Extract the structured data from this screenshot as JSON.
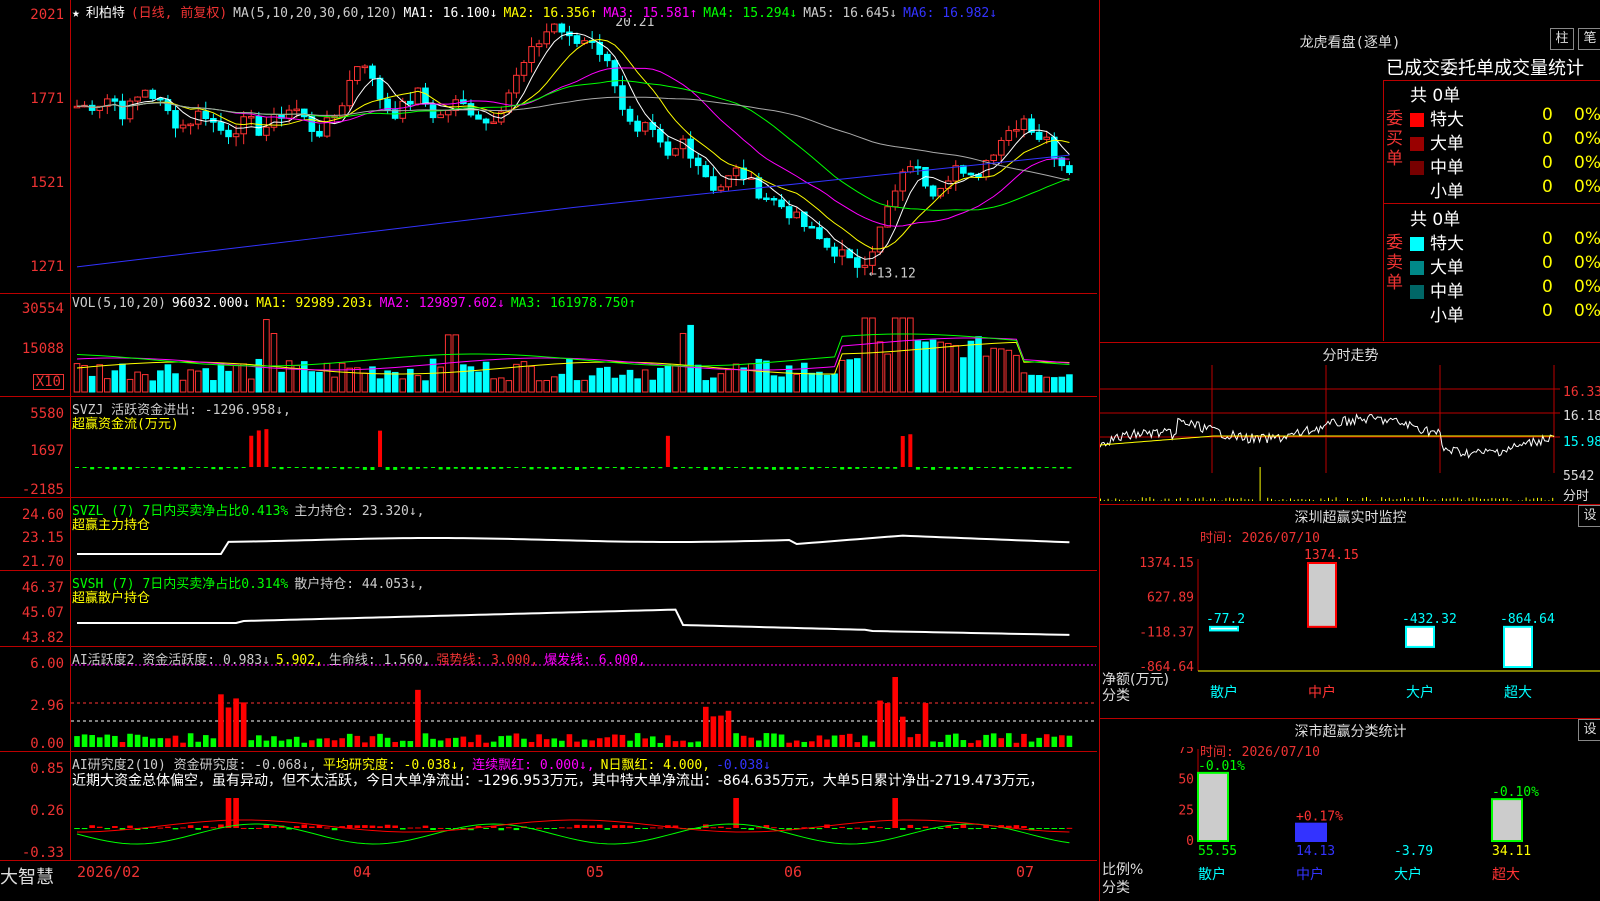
{
  "stock": {
    "star": "★",
    "name": "利柏特",
    "mode": "(日线, 前复权)"
  },
  "main_hdr": [
    {
      "t": "MA(5,10,20,30,60,120)",
      "c": "#ccc"
    },
    {
      "t": "MA1: 16.100↓",
      "c": "#fff"
    },
    {
      "t": "MA2: 16.356↑",
      "c": "#ff0"
    },
    {
      "t": "MA3: 15.581↑",
      "c": "#f0f"
    },
    {
      "t": "MA4: 15.294↓",
      "c": "#0f0"
    },
    {
      "t": "MA5: 16.645↓",
      "c": "#ccc"
    },
    {
      "t": "MA6: 16.982↓",
      "c": "#33f"
    }
  ],
  "main_axis": [
    "2021",
    "1771",
    "1521",
    "1271"
  ],
  "annot": {
    "high": "20.21",
    "low": "←13.12"
  },
  "vol_hdr": [
    {
      "t": "VOL(5,10,20)",
      "c": "#ccc"
    },
    {
      "t": "96032.000↓",
      "c": "#fff"
    },
    {
      "t": "MA1: 92989.203↓",
      "c": "#ff0"
    },
    {
      "t": "MA2: 129897.602↓",
      "c": "#f0f"
    },
    {
      "t": "MA3: 161978.750↑",
      "c": "#0f0"
    }
  ],
  "vol_axis": [
    "30554",
    "15088"
  ],
  "vol_unit": "X10",
  "svzj_hdr": [
    {
      "t": "SVZJ  活跃资金进出: -1296.958↓,",
      "c": "#ccc"
    }
  ],
  "svzj_sub": "超赢资金流(万元)",
  "svzj_axis": [
    "5580",
    "1697",
    "-2185"
  ],
  "svzl_hdr": [
    {
      "t": "SVZL (7) 7日内买卖净占比0.413%",
      "c": "#0f0"
    },
    {
      "t": "主力持仓: 23.320↓,",
      "c": "#ccc"
    }
  ],
  "svzl_sub": "超赢主力持仓",
  "svzl_axis": [
    "24.60",
    "23.15",
    "21.70"
  ],
  "svsh_hdr": [
    {
      "t": "SVSH (7) 7日内买卖净占比0.314%",
      "c": "#0f0"
    },
    {
      "t": "散户持仓: 44.053↓,",
      "c": "#ccc"
    }
  ],
  "svsh_sub": "超赢散户持仓",
  "svsh_axis": [
    "46.37",
    "45.07",
    "43.82"
  ],
  "ai1_hdr": [
    {
      "t": "AI活跃度2 资金活跃度: 0.983↓",
      "c": "#ccc"
    },
    {
      "t": "5.902,",
      "c": "#ff0"
    },
    {
      "t": "生命线: 1.560,",
      "c": "#ccc"
    },
    {
      "t": "强势线: 3.000,",
      "c": "#e33"
    },
    {
      "t": "爆发线: 6.000,",
      "c": "#f0f"
    }
  ],
  "ai1_axis": [
    "6.00",
    "2.96",
    "0.00"
  ],
  "ai2_hdr": [
    {
      "t": "AI研究度2(10) 资金研究度: -0.068↓,",
      "c": "#ccc"
    },
    {
      "t": "平均研究度: -0.038↓,",
      "c": "#ff0"
    },
    {
      "t": "连续飘红: 0.000↓,",
      "c": "#f0f"
    },
    {
      "t": "N日飘红: 4.000,",
      "c": "#ff0"
    },
    {
      "t": "-0.038↓",
      "c": "#33f"
    }
  ],
  "ai2_text": "近期大资金总体偏空，虽有异动，但不太活跃，今日大单净流出：-1296.953万元，其中特大单净流出：-864.635万元，大单5日累计净出-2719.473万元，",
  "ai2_axis": [
    "0.85",
    "0.26",
    "-0.33"
  ],
  "xaxis": {
    "brand": "大智慧",
    "labels": [
      "2026/02",
      "04",
      "05",
      "06",
      "07"
    ]
  },
  "lhb": {
    "title": "龙虎看盘(逐单)",
    "btn1": "柱",
    "btn2": "笔",
    "subtitle": "已成交委托单成交量统计",
    "buy": {
      "label": "委买单",
      "count": "共 0单",
      "rows": [
        {
          "name": "特大",
          "v": "0",
          "p": "0%",
          "c": "#f00"
        },
        {
          "name": "大单",
          "v": "0",
          "p": "0%",
          "c": "#900"
        },
        {
          "name": "中单",
          "v": "0",
          "p": "0%",
          "c": "#700"
        },
        {
          "name": "小单",
          "v": "0",
          "p": "0%",
          "c": "#000"
        }
      ]
    },
    "sell": {
      "label": "委卖单",
      "count": "共 0单",
      "rows": [
        {
          "name": "特大",
          "v": "0",
          "p": "0%",
          "c": "#0ff"
        },
        {
          "name": "大单",
          "v": "0",
          "p": "0%",
          "c": "#088"
        },
        {
          "name": "中单",
          "v": "0",
          "p": "0%",
          "c": "#066"
        },
        {
          "name": "小单",
          "v": "0",
          "p": "0%",
          "c": "#000"
        }
      ]
    }
  },
  "intraday": {
    "title": "分时走势",
    "axis": [
      "16.33",
      "16.18",
      "15.98"
    ],
    "vol": "5542",
    "vlabel": "分时"
  },
  "realtime": {
    "title": "深圳超赢实时监控",
    "btn": "设",
    "time": "时间: 2026/07/10",
    "axis": [
      "1374.15",
      "627.89",
      "-118.37",
      "-864.64"
    ],
    "ylabel": "净额(万元)",
    "xlabel": "分类",
    "bars": [
      {
        "cat": "散户",
        "v": -77.2,
        "label": "-77.2"
      },
      {
        "cat": "中户",
        "v": 1374.15,
        "label": "1374.15"
      },
      {
        "cat": "大户",
        "v": -432.32,
        "label": "-432.32"
      },
      {
        "cat": "超大",
        "v": -864.64,
        "label": "-864.64"
      }
    ]
  },
  "classify": {
    "title": "深市超赢分类统计",
    "btn": "设",
    "time": "时间: 2026/07/10",
    "axis": [
      "75",
      "50",
      "25",
      "0"
    ],
    "ylabel": "比例%",
    "xlabel": "分类",
    "bars": [
      {
        "cat": "散户",
        "v": 55.55,
        "label": "55.55",
        "chg": "-0.01%"
      },
      {
        "cat": "中户",
        "v": 14.13,
        "label": "14.13",
        "chg": "+0.17%"
      },
      {
        "cat": "大户",
        "v": -3.79,
        "label": "-3.79",
        "chg": ""
      },
      {
        "cat": "超大",
        "v": 34.11,
        "label": "34.11",
        "chg": "-0.10%"
      }
    ]
  },
  "chart_data": {
    "type": "line",
    "title": "利柏特 (日线, 前复权)",
    "x": [
      "2026/02",
      "04",
      "05",
      "06",
      "07"
    ],
    "ylim": [
      12.71,
      20.21
    ],
    "annotations": {
      "high": 20.21,
      "low": 13.12
    },
    "series": [
      {
        "name": "MA1",
        "last": 16.1
      },
      {
        "name": "MA2",
        "last": 16.356
      },
      {
        "name": "MA3",
        "last": 15.581
      },
      {
        "name": "MA4",
        "last": 15.294
      },
      {
        "name": "MA5",
        "last": 16.645
      },
      {
        "name": "MA6",
        "last": 16.982
      }
    ]
  }
}
